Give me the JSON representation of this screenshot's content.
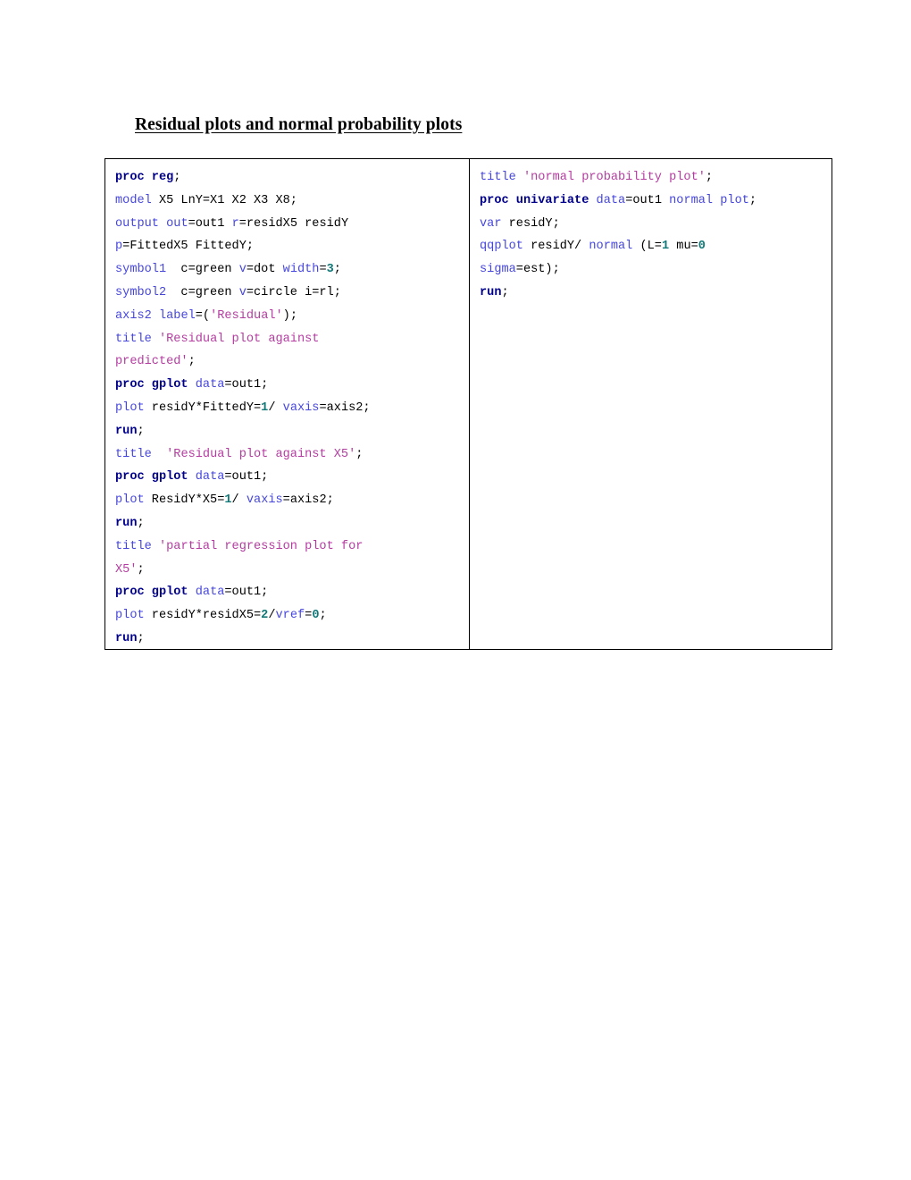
{
  "document": {
    "title": "Residual plots and normal probability plots"
  },
  "code_table": {
    "columns": [
      {
        "name": "left-code-column",
        "lines": [
          [
            {
              "t": "proc",
              "v": "proc reg"
            },
            {
              "t": "plain",
              "v": ";"
            }
          ],
          [
            {
              "t": "kw",
              "v": "model"
            },
            {
              "t": "plain",
              "v": " X5 LnY=X1 X2 X3 X8;"
            }
          ],
          [
            {
              "t": "kw",
              "v": "output"
            },
            {
              "t": "plain",
              "v": " "
            },
            {
              "t": "kw",
              "v": "out"
            },
            {
              "t": "plain",
              "v": "=out1 "
            },
            {
              "t": "kw",
              "v": "r"
            },
            {
              "t": "plain",
              "v": "=residX5 residY"
            }
          ],
          [
            {
              "t": "kw",
              "v": "p"
            },
            {
              "t": "plain",
              "v": "=FittedX5 FittedY;"
            }
          ],
          [
            {
              "t": "kw",
              "v": "symbol1"
            },
            {
              "t": "plain",
              "v": "  c=green "
            },
            {
              "t": "kw",
              "v": "v"
            },
            {
              "t": "plain",
              "v": "=dot "
            },
            {
              "t": "kw",
              "v": "width"
            },
            {
              "t": "plain",
              "v": "="
            },
            {
              "t": "num",
              "v": "3"
            },
            {
              "t": "plain",
              "v": ";"
            }
          ],
          [
            {
              "t": "kw",
              "v": "symbol2"
            },
            {
              "t": "plain",
              "v": "  c=green "
            },
            {
              "t": "kw",
              "v": "v"
            },
            {
              "t": "plain",
              "v": "=circle i=rl;"
            }
          ],
          [
            {
              "t": "kw",
              "v": "axis2"
            },
            {
              "t": "plain",
              "v": " "
            },
            {
              "t": "kw",
              "v": "label"
            },
            {
              "t": "plain",
              "v": "=("
            },
            {
              "t": "str",
              "v": "'Residual'"
            },
            {
              "t": "plain",
              "v": ");"
            }
          ],
          [
            {
              "t": "kw",
              "v": "title"
            },
            {
              "t": "plain",
              "v": " "
            },
            {
              "t": "str",
              "v": "'Residual plot against"
            }
          ],
          [
            {
              "t": "str",
              "v": "predicted'"
            },
            {
              "t": "plain",
              "v": ";"
            }
          ],
          [
            {
              "t": "proc",
              "v": "proc gplot"
            },
            {
              "t": "plain",
              "v": " "
            },
            {
              "t": "kw",
              "v": "data"
            },
            {
              "t": "plain",
              "v": "=out1;"
            }
          ],
          [
            {
              "t": "kw",
              "v": "plot"
            },
            {
              "t": "plain",
              "v": " residY*FittedY="
            },
            {
              "t": "num",
              "v": "1"
            },
            {
              "t": "plain",
              "v": "/ "
            },
            {
              "t": "kw",
              "v": "vaxis"
            },
            {
              "t": "plain",
              "v": "=axis2;"
            }
          ],
          [
            {
              "t": "proc",
              "v": "run"
            },
            {
              "t": "plain",
              "v": ";"
            }
          ],
          [
            {
              "t": "kw",
              "v": "title"
            },
            {
              "t": "plain",
              "v": "  "
            },
            {
              "t": "str",
              "v": "'Residual plot against X5'"
            },
            {
              "t": "plain",
              "v": ";"
            }
          ],
          [
            {
              "t": "proc",
              "v": "proc gplot"
            },
            {
              "t": "plain",
              "v": " "
            },
            {
              "t": "kw",
              "v": "data"
            },
            {
              "t": "plain",
              "v": "=out1;"
            }
          ],
          [
            {
              "t": "kw",
              "v": "plot"
            },
            {
              "t": "plain",
              "v": " ResidY*X5="
            },
            {
              "t": "num",
              "v": "1"
            },
            {
              "t": "plain",
              "v": "/ "
            },
            {
              "t": "kw",
              "v": "vaxis"
            },
            {
              "t": "plain",
              "v": "=axis2;"
            }
          ],
          [
            {
              "t": "proc",
              "v": "run"
            },
            {
              "t": "plain",
              "v": ";"
            }
          ],
          [
            {
              "t": "kw",
              "v": "title"
            },
            {
              "t": "plain",
              "v": " "
            },
            {
              "t": "str",
              "v": "'partial regression plot for"
            }
          ],
          [
            {
              "t": "str",
              "v": "X5'"
            },
            {
              "t": "plain",
              "v": ";"
            }
          ],
          [
            {
              "t": "proc",
              "v": "proc gplot"
            },
            {
              "t": "plain",
              "v": " "
            },
            {
              "t": "kw",
              "v": "data"
            },
            {
              "t": "plain",
              "v": "=out1;"
            }
          ],
          [
            {
              "t": "kw",
              "v": "plot"
            },
            {
              "t": "plain",
              "v": " residY*residX5="
            },
            {
              "t": "num",
              "v": "2"
            },
            {
              "t": "plain",
              "v": "/"
            },
            {
              "t": "kw",
              "v": "vref"
            },
            {
              "t": "plain",
              "v": "="
            },
            {
              "t": "num",
              "v": "0"
            },
            {
              "t": "plain",
              "v": ";"
            }
          ],
          [
            {
              "t": "proc",
              "v": "run"
            },
            {
              "t": "plain",
              "v": ";"
            }
          ]
        ]
      },
      {
        "name": "right-code-column",
        "lines": [
          [
            {
              "t": "kw",
              "v": "title"
            },
            {
              "t": "plain",
              "v": " "
            },
            {
              "t": "str",
              "v": "'normal probability plot'"
            },
            {
              "t": "plain",
              "v": ";"
            }
          ],
          [
            {
              "t": "proc",
              "v": "proc univariate"
            },
            {
              "t": "plain",
              "v": " "
            },
            {
              "t": "kw",
              "v": "data"
            },
            {
              "t": "plain",
              "v": "=out1 "
            },
            {
              "t": "kw",
              "v": "normal"
            },
            {
              "t": "plain",
              "v": " "
            },
            {
              "t": "kw",
              "v": "plot"
            },
            {
              "t": "plain",
              "v": ";"
            }
          ],
          [
            {
              "t": "kw",
              "v": "var"
            },
            {
              "t": "plain",
              "v": " residY;"
            }
          ],
          [
            {
              "t": "kw",
              "v": "qqplot"
            },
            {
              "t": "plain",
              "v": " residY/ "
            },
            {
              "t": "kw",
              "v": "normal"
            },
            {
              "t": "plain",
              "v": " (L="
            },
            {
              "t": "num",
              "v": "1"
            },
            {
              "t": "plain",
              "v": " mu="
            },
            {
              "t": "num",
              "v": "0"
            }
          ],
          [
            {
              "t": "kw",
              "v": "sigma"
            },
            {
              "t": "plain",
              "v": "=est);"
            }
          ],
          [
            {
              "t": "proc",
              "v": "run"
            },
            {
              "t": "plain",
              "v": ";"
            }
          ]
        ]
      }
    ]
  },
  "colors": {
    "proc_keyword": "#00008B",
    "statement_keyword": "#4646DC",
    "string_literal": "#B43CA0",
    "number_literal": "#127878",
    "plain_text": "#000000",
    "table_border": "#000000",
    "page_background": "#FFFFFF"
  }
}
